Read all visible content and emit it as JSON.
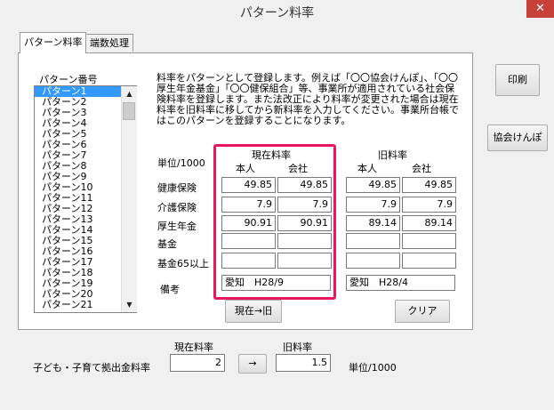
{
  "window": {
    "title": "パターン料率",
    "close_label": "✕"
  },
  "tabs": [
    {
      "label": "パターン料率",
      "active": true
    },
    {
      "label": "端数処理",
      "active": false
    }
  ],
  "pattern_list": {
    "header": "パターン番号",
    "items": [
      "パターン1",
      "パターン2",
      "パターン3",
      "パターン4",
      "パターン5",
      "パターン6",
      "パターン7",
      "パターン8",
      "パターン9",
      "パターン10",
      "パターン11",
      "パターン12",
      "パターン13",
      "パターン14",
      "パターン15",
      "パターン16",
      "パターン17",
      "パターン18",
      "パターン19",
      "パターン20",
      "パターン21"
    ],
    "selected_index": 0
  },
  "description": "料率をパターンとして登録します。例えば「〇〇協会けんぽ」、「〇〇厚生年金基金」「〇〇健保組合」等、事業所が適用されている社会保険料率を登録します。また法改正により料率が変更された場合は現在料率を旧料率に移してから新料率を入力してください。事業所台帳ではこのパターンを登録することになります。",
  "rates": {
    "unit": "単位/1000",
    "current_header": "現在料率",
    "old_header": "旧料率",
    "person_label": "本人",
    "company_label": "会社",
    "rows": [
      {
        "label": "健康保険",
        "cur_person": "49.85",
        "cur_company": "49.85",
        "old_person": "49.85",
        "old_company": "49.85"
      },
      {
        "label": "介護保険",
        "cur_person": "7.9",
        "cur_company": "7.9",
        "old_person": "7.9",
        "old_company": "7.9"
      },
      {
        "label": "厚生年金",
        "cur_person": "90.91",
        "cur_company": "90.91",
        "old_person": "89.14",
        "old_company": "89.14"
      },
      {
        "label": "基金",
        "cur_person": "",
        "cur_company": "",
        "old_person": "",
        "old_company": ""
      },
      {
        "label": "基金65以上",
        "cur_person": "",
        "cur_company": "",
        "old_person": "",
        "old_company": ""
      }
    ],
    "remarks_label": "備考",
    "remarks_current": "愛知　H28/9",
    "remarks_old": "愛知　H28/4"
  },
  "buttons": {
    "copy_label": "現在→旧",
    "clear_label": "クリア",
    "print_label": "印刷",
    "kyokai_label": "協会けんぽ"
  },
  "child_rate": {
    "label": "子ども・子育て拠出金料率",
    "current_header": "現在料率",
    "old_header": "旧料率",
    "current_value": "2",
    "arrow_label": "→",
    "old_value": "1.5",
    "unit": "単位/1000"
  }
}
